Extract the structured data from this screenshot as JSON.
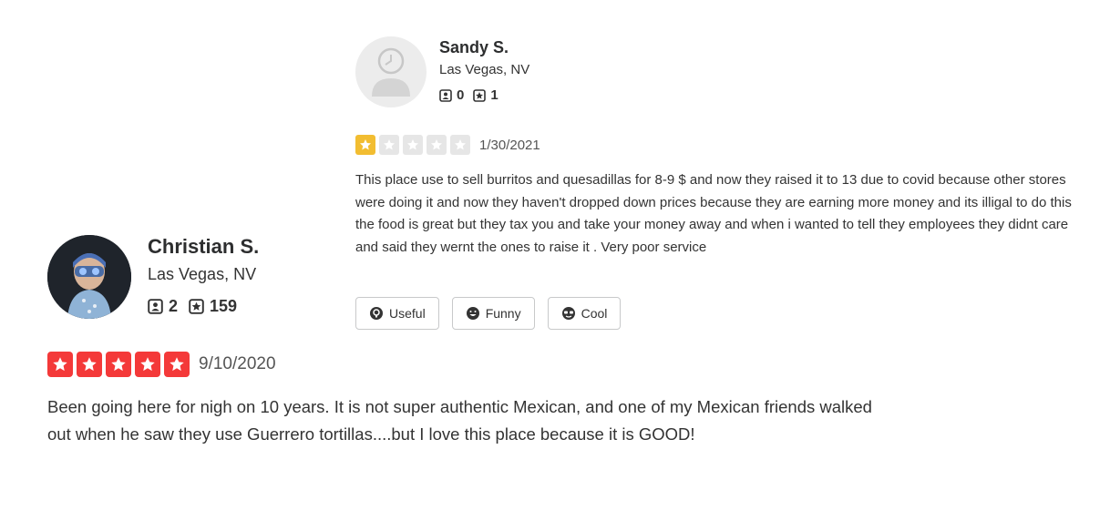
{
  "review1": {
    "user_name": "Sandy S.",
    "location": "Las Vegas, NV",
    "friends_count": "0",
    "reviews_count": "1",
    "rating": 1,
    "max_rating": 5,
    "date": "1/30/2021",
    "text": "This place use to sell burritos and quesadillas for 8-9 $ and now they raised it to 13 due to covid because other stores were doing it and now they haven't dropped down prices because they are earning more money and its illigal to do this the food is great but they tax you and take your money away and when i wanted to tell they employees they didnt care and said they wernt the ones to raise it . Very poor service",
    "buttons": {
      "useful": "Useful",
      "funny": "Funny",
      "cool": "Cool"
    }
  },
  "review2": {
    "user_name": "Christian S.",
    "location": "Las Vegas, NV",
    "friends_count": "2",
    "reviews_count": "159",
    "rating": 5,
    "max_rating": 5,
    "date": "9/10/2020",
    "text": "Been going here for nigh on 10 years. It is not super authentic Mexican, and one of my Mexican friends walked out when he saw they use Guerrero tortillas....but I love this place because it is GOOD!"
  },
  "colors": {
    "star_one": "#f2bd31",
    "star_five": "#f43939",
    "star_empty": "#e6e6e6"
  }
}
